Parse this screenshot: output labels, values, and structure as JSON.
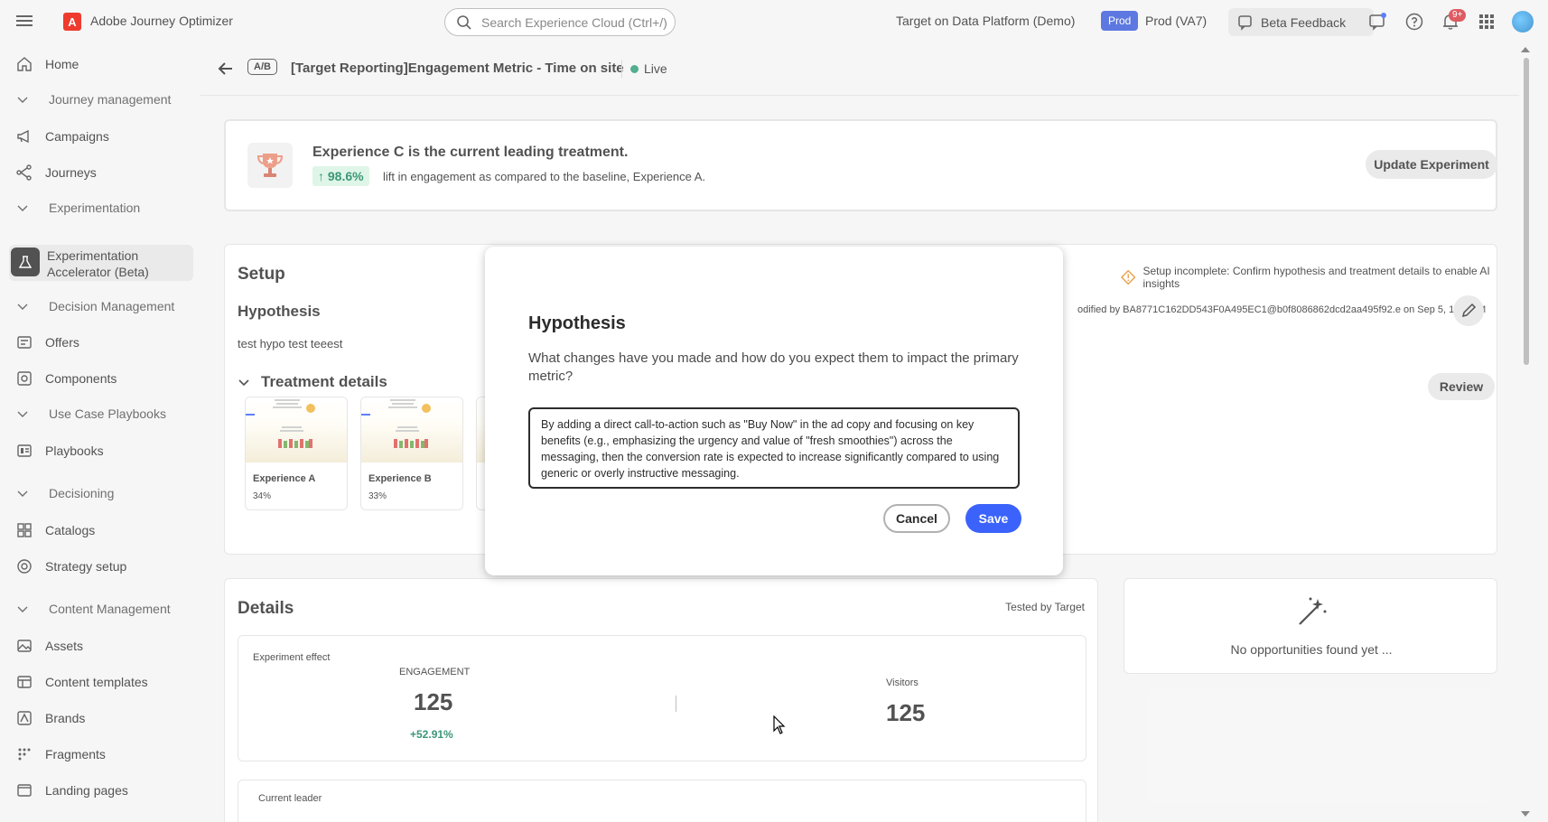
{
  "topbar": {
    "app_title": "Adobe Journey Optimizer",
    "search_placeholder": "Search Experience Cloud (Ctrl+/)",
    "org": "Target on Data Platform (Demo)",
    "sandbox_badge": "Prod",
    "sandbox_name": "Prod (VA7)",
    "beta_feedback": "Beta Feedback",
    "notification_count": "9+"
  },
  "sidebar": {
    "items": [
      {
        "label": "Home",
        "icon": "home-icon"
      },
      {
        "section": "Journey management"
      },
      {
        "label": "Campaigns",
        "icon": "megaphone-icon"
      },
      {
        "label": "Journeys",
        "icon": "journey-icon"
      },
      {
        "section": "Experimentation"
      },
      {
        "label": "Experimentation Accelerator (Beta)",
        "icon": "beaker-icon"
      },
      {
        "section": "Decision Management"
      },
      {
        "label": "Offers",
        "icon": "offers-icon"
      },
      {
        "label": "Components",
        "icon": "components-icon"
      },
      {
        "section": "Use Case Playbooks"
      },
      {
        "label": "Playbooks",
        "icon": "playbooks-icon"
      },
      {
        "section": "Decisioning"
      },
      {
        "label": "Catalogs",
        "icon": "catalogs-icon"
      },
      {
        "label": "Strategy setup",
        "icon": "strategy-icon"
      },
      {
        "section": "Content Management"
      },
      {
        "label": "Assets",
        "icon": "assets-icon"
      },
      {
        "label": "Content templates",
        "icon": "templates-icon"
      },
      {
        "label": "Brands",
        "icon": "brands-icon"
      },
      {
        "label": "Fragments",
        "icon": "fragments-icon"
      },
      {
        "label": "Landing pages",
        "icon": "landing-pages-icon"
      }
    ],
    "labels": {
      "home": "Home",
      "journey_mgmt": "Journey management",
      "campaigns": "Campaigns",
      "journeys": "Journeys",
      "experimentation": "Experimentation",
      "exp_acc_1": "Experimentation",
      "exp_acc_2": "Accelerator (Beta)",
      "decision_mgmt": "Decision Management",
      "offers": "Offers",
      "components": "Components",
      "use_case": "Use Case Playbooks",
      "playbooks": "Playbooks",
      "decisioning": "Decisioning",
      "catalogs": "Catalogs",
      "strategy": "Strategy setup",
      "content_mgmt": "Content Management",
      "assets": "Assets",
      "content_templates": "Content templates",
      "brands": "Brands",
      "fragments": "Fragments",
      "landing_pages": "Landing pages"
    }
  },
  "header": {
    "type_tag": "A/B",
    "title": "[Target Reporting]Engagement Metric - Time on site",
    "status": "Live"
  },
  "leader": {
    "title": "Experience C is the current leading treatment.",
    "lift": "↑ 98.6%",
    "lift_text": "lift in engagement as compared to the baseline, Experience A.",
    "update_button": "Update Experiment"
  },
  "setup": {
    "title": "Setup",
    "warning": "Setup incomplete: Confirm hypothesis and treatment details to enable AI insights",
    "hypothesis_title": "Hypothesis",
    "hypothesis_text": "test hypo test teeest",
    "modified": "odified by BA8771C162DD543F0A495EC1@b0f8086862dcd2aa495f92.e on Sep 5, 1:49 PM",
    "treatment_title": "Treatment details",
    "review_button": "Review",
    "treatments": [
      {
        "name": "Experience A",
        "pct": "34%"
      },
      {
        "name": "Experience B",
        "pct": "33%"
      }
    ]
  },
  "details": {
    "title": "Details",
    "tested_by": "Tested by Target",
    "effect_label": "Experiment effect",
    "engagement_label": "ENGAGEMENT",
    "engagement_value": "125",
    "engagement_delta": "+52.91%",
    "visitors_label": "Visitors",
    "visitors_value": "125",
    "leader_label": "Current leader"
  },
  "opportunities": {
    "text": "No opportunities found yet ..."
  },
  "modal": {
    "title": "Hypothesis",
    "question": "What changes have you made and how do you expect them to impact the primary metric?",
    "value": "By adding a direct call-to-action such as \"Buy Now\" in the ad copy and focusing on key benefits (e.g., emphasizing the urgency and value of \"fresh smoothies\") across the messaging, then the conversion rate is expected to increase significantly compared to using generic or overly instructive messaging.",
    "cancel": "Cancel",
    "save": "Save"
  },
  "colors": {
    "accent": "#3b63fb",
    "live": "#2d9d78",
    "positive": "#12805c",
    "warning": "#e68619",
    "brand": "#eb1000"
  }
}
